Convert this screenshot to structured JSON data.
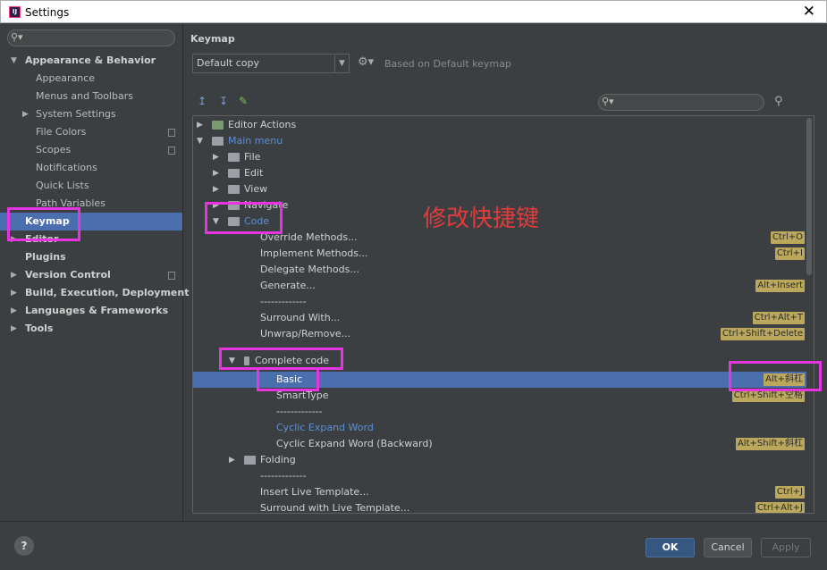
{
  "window": {
    "title": "Settings",
    "app_icon": "IJ",
    "close_glyph": "✕"
  },
  "sidebar": {
    "search_placeholder": "",
    "items": [
      {
        "label": "Appearance & Behavior",
        "expanded": true,
        "bold": true
      },
      {
        "label": "Appearance"
      },
      {
        "label": "Menus and Toolbars"
      },
      {
        "label": "System Settings"
      },
      {
        "label": "File Colors"
      },
      {
        "label": "Scopes"
      },
      {
        "label": "Notifications"
      },
      {
        "label": "Quick Lists"
      },
      {
        "label": "Path Variables"
      },
      {
        "label": "Keymap",
        "selected": true,
        "bold": true
      },
      {
        "label": "Editor",
        "bold": true
      },
      {
        "label": "Plugins",
        "bold": true
      },
      {
        "label": "Version Control",
        "bold": true
      },
      {
        "label": "Build, Execution, Deployment",
        "bold": true
      },
      {
        "label": "Languages & Frameworks",
        "bold": true
      },
      {
        "label": "Tools",
        "bold": true
      }
    ]
  },
  "main": {
    "heading": "Keymap",
    "keymap_select": "Default copy",
    "based_on": "Based on Default keymap",
    "tree": [
      {
        "label": "Editor Actions"
      },
      {
        "label": "Main menu"
      },
      {
        "label": "File"
      },
      {
        "label": "Edit"
      },
      {
        "label": "View"
      },
      {
        "label": "Navigate"
      },
      {
        "label": "Code"
      },
      {
        "label": "Override Methods...",
        "shortcut": "Ctrl+O"
      },
      {
        "label": "Implement Methods...",
        "shortcut": "Ctrl+I"
      },
      {
        "label": "Delegate Methods..."
      },
      {
        "label": "Generate...",
        "shortcut": "Alt+Insert"
      },
      {
        "label": "-------------"
      },
      {
        "label": "Surround With...",
        "shortcut": "Ctrl+Alt+T"
      },
      {
        "label": "Unwrap/Remove...",
        "shortcut": "Ctrl+Shift+Delete"
      },
      {
        "label": "Complete code"
      },
      {
        "label": "Basic",
        "shortcut": "Alt+斜杠"
      },
      {
        "label": "SmartType",
        "shortcut": "Ctrl+Shift+空格"
      },
      {
        "label": "-------------"
      },
      {
        "label": "Cyclic Expand Word"
      },
      {
        "label": "Cyclic Expand Word (Backward)",
        "shortcut": "Alt+Shift+斜杠"
      },
      {
        "label": "Folding"
      },
      {
        "label": "-------------"
      },
      {
        "label": "Insert Live Template...",
        "shortcut": "Ctrl+J"
      },
      {
        "label": "Surround with Live Template...",
        "shortcut": "Ctrl+Alt+J"
      }
    ],
    "annotation": "修改快捷键"
  },
  "footer": {
    "help": "?",
    "ok": "OK",
    "cancel": "Cancel",
    "apply": "Apply"
  }
}
